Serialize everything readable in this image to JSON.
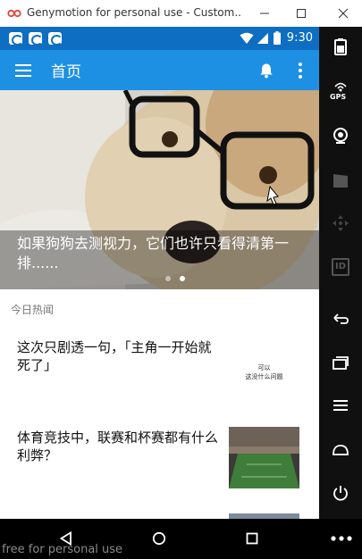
{
  "window": {
    "title": "Genymotion for personal use - Custom...",
    "controls": [
      "minimize",
      "maximize",
      "close"
    ]
  },
  "status_bar": {
    "time": "9:30",
    "notification_icons": [
      "notif-icon-1",
      "notif-icon-2",
      "notif-icon-3"
    ],
    "color": "#0d6ec2"
  },
  "app_bar": {
    "title": "首页",
    "color": "#1e90e3"
  },
  "banner": {
    "caption": "如果狗狗去测视力，它们也许只看得清第一排......",
    "dots": 2,
    "active_dot": 1
  },
  "feed": {
    "section_label": "今日热闻",
    "items": [
      {
        "title": "这次只剧透一句，「主角一开始就死了」",
        "thumb_text_line1": "可以",
        "thumb_text_line2": "这没什么问题"
      },
      {
        "title": "体育竞技中，联赛和杯赛都有什么利弊？"
      }
    ]
  },
  "sidebar": {
    "gps_label": "GPS",
    "id_label": "ID"
  },
  "watermark": "free for personal use"
}
